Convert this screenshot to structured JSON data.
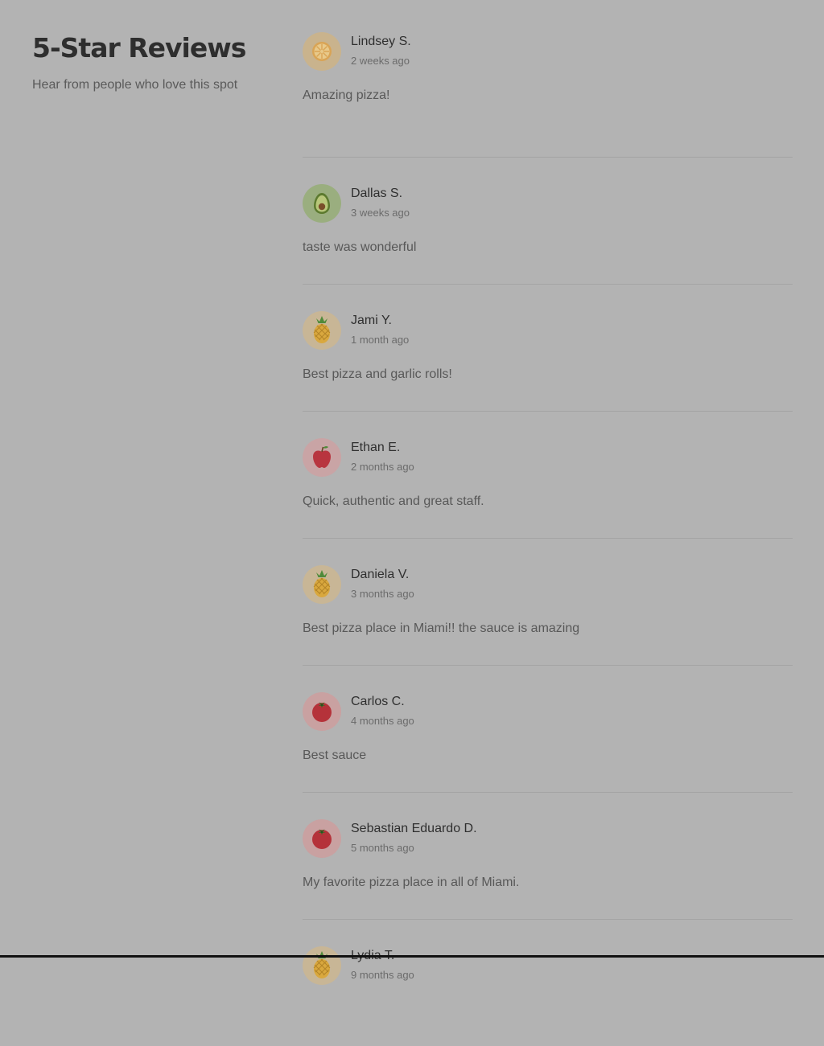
{
  "header": {
    "title": "5-Star Reviews",
    "subtitle": "Hear from people who love this spot"
  },
  "reviews": [
    {
      "name": "Lindsey S.",
      "date": "2 weeks ago",
      "text": "Amazing pizza!",
      "avatar_icon": "orange-slice-icon",
      "avatar_bg": "#c9b38d"
    },
    {
      "name": "Dallas S.",
      "date": "3 weeks ago",
      "text": "taste was wonderful",
      "avatar_icon": "avocado-icon",
      "avatar_bg": "#9aae7f"
    },
    {
      "name": "Jami Y.",
      "date": "1 month ago",
      "text": "Best pizza and garlic rolls!",
      "avatar_icon": "pineapple-icon",
      "avatar_bg": "#c8b696"
    },
    {
      "name": "Ethan E.",
      "date": "2 months ago",
      "text": "Quick, authentic and great staff.",
      "avatar_icon": "apple-icon",
      "avatar_bg": "#c9a4a5"
    },
    {
      "name": "Daniela V.",
      "date": "3 months ago",
      "text": "Best pizza place in Miami!! the sauce is amazing",
      "avatar_icon": "pineapple-icon",
      "avatar_bg": "#c8b696"
    },
    {
      "name": "Carlos C.",
      "date": "4 months ago",
      "text": "Best sauce",
      "avatar_icon": "tomato-icon",
      "avatar_bg": "#c9a1a1"
    },
    {
      "name": "Sebastian Eduardo D.",
      "date": "5 months ago",
      "text": "My favorite pizza place in all of Miami.",
      "avatar_icon": "tomato-icon",
      "avatar_bg": "#c9a1a1"
    },
    {
      "name": "Lydia T.",
      "date": "9 months ago",
      "text": "",
      "avatar_icon": "pineapple-icon",
      "avatar_bg": "#c8b696"
    }
  ]
}
